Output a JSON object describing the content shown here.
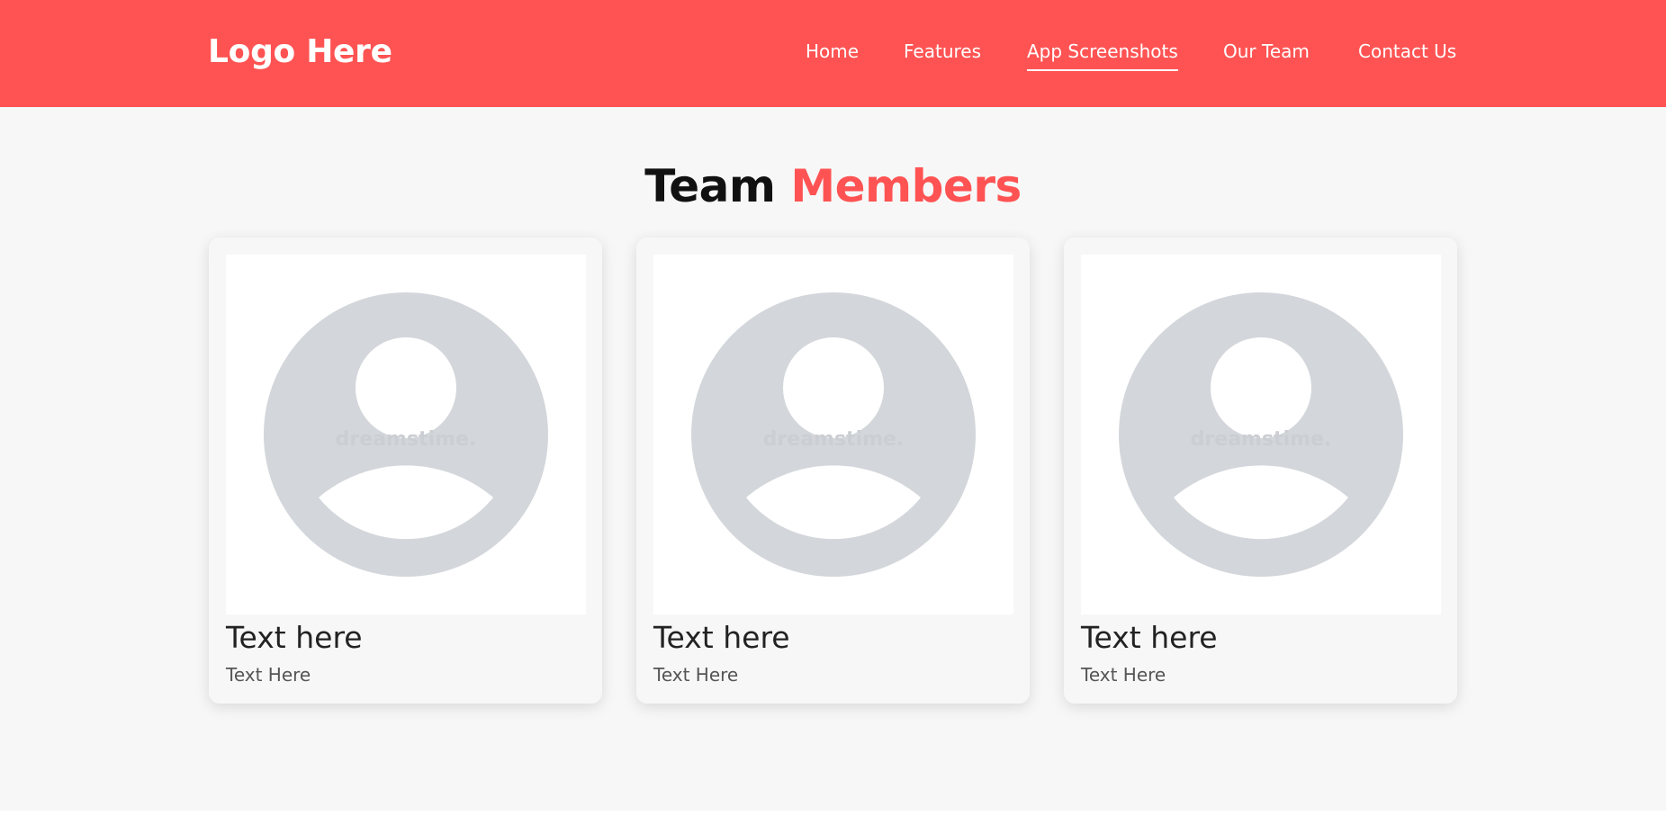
{
  "header": {
    "logo": "Logo Here",
    "nav": [
      {
        "label": "Home",
        "active": false
      },
      {
        "label": "Features",
        "active": false
      },
      {
        "label": "App Screenshots",
        "active": true
      },
      {
        "label": "Our Team",
        "active": false
      },
      {
        "label": "Contact Us",
        "active": false
      }
    ]
  },
  "team": {
    "title_part1": "Team",
    "title_part2": "Members",
    "members": [
      {
        "name": "Text here",
        "role": "Text Here",
        "watermark": "dreamstime."
      },
      {
        "name": "Text here",
        "role": "Text Here",
        "watermark": "dreamstime."
      },
      {
        "name": "Text here",
        "role": "Text Here",
        "watermark": "dreamstime."
      }
    ]
  },
  "colors": {
    "brand": "#ff5353",
    "section_bg": "#f7f7f7",
    "avatar_grey": "#d3d6da"
  },
  "icons": {
    "avatar": "person-avatar-icon"
  }
}
